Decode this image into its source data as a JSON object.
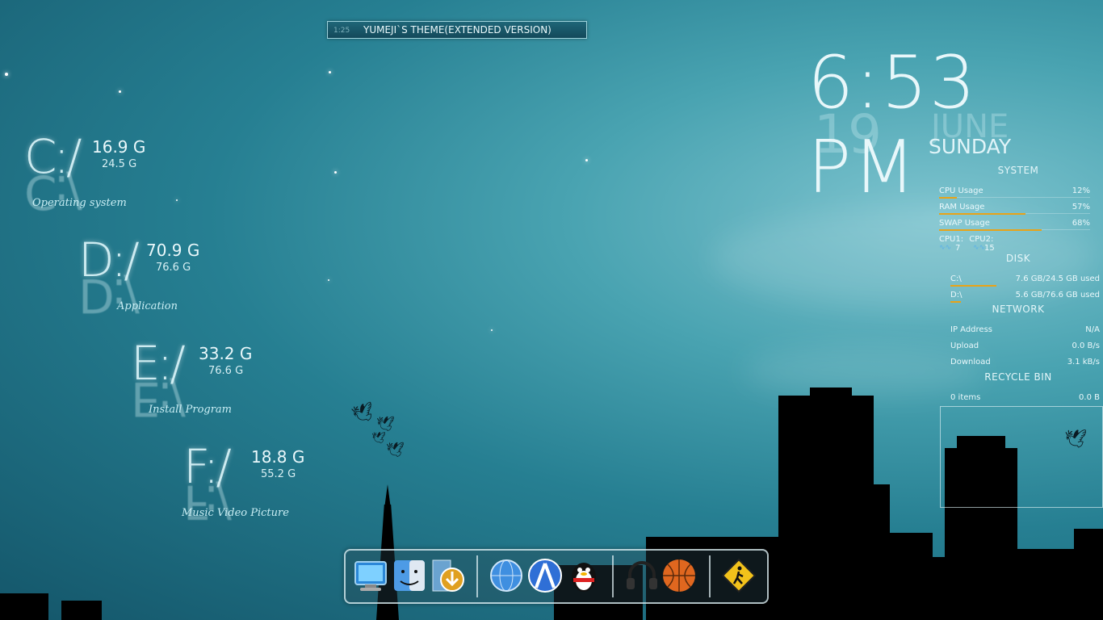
{
  "media_player": {
    "time": "1:25",
    "track": "YUMEJI`S THEME(EXTENDED VERSION)"
  },
  "drives": [
    {
      "letter": "C:/",
      "free": "16.9 G",
      "total": "24.5 G",
      "label": "Operating system"
    },
    {
      "letter": "D:/",
      "free": "70.9 G",
      "total": "76.6 G",
      "label": "Application"
    },
    {
      "letter": "E:/",
      "free": "33.2 G",
      "total": "76.6 G",
      "label": "Install Program"
    },
    {
      "letter": "F:/",
      "free": "18.8 G",
      "total": "55.2 G",
      "label": "Music Video Picture"
    }
  ],
  "clock": {
    "time": "6:53 PM",
    "day": "19",
    "month": "JUNE",
    "weekday": "SUNDAY"
  },
  "system": {
    "title": "SYSTEM",
    "rows": [
      {
        "label": "CPU Usage",
        "value": "12%",
        "level": 0.12
      },
      {
        "label": "RAM Usage",
        "value": "57%",
        "level": 0.57
      },
      {
        "label": "SWAP Usage",
        "value": "68%",
        "level": 0.68
      }
    ],
    "cpu1_label": "CPU1:",
    "cpu1_value": "7",
    "cpu2_label": "CPU2:",
    "cpu2_value": "15"
  },
  "disk": {
    "title": "DISK",
    "rows": [
      {
        "label": "C:\\",
        "value": "7.6 GB/24.5 GB used",
        "level": 0.31
      },
      {
        "label": "D:\\",
        "value": "5.6 GB/76.6 GB used",
        "level": 0.07
      }
    ]
  },
  "network": {
    "title": "NETWORK",
    "rows": [
      {
        "label": "IP Address",
        "value": "N/A"
      },
      {
        "label": "Upload",
        "value": "0.0 B/s"
      },
      {
        "label": "Download",
        "value": "3.1 kB/s"
      }
    ]
  },
  "recycle_bin": {
    "title": "RECYCLE BIN",
    "items": "0 items",
    "size": "0.0 B"
  },
  "dock": {
    "icons": [
      "monitor-icon",
      "finder-icon",
      "download-icon",
      "globe-icon",
      "browser-icon",
      "qq-penguin-icon",
      "headphones-icon",
      "basketball-icon",
      "pedestrian-sign-icon"
    ]
  },
  "colors": {
    "accent_bar": "#e8a318",
    "background": "#267f92"
  }
}
